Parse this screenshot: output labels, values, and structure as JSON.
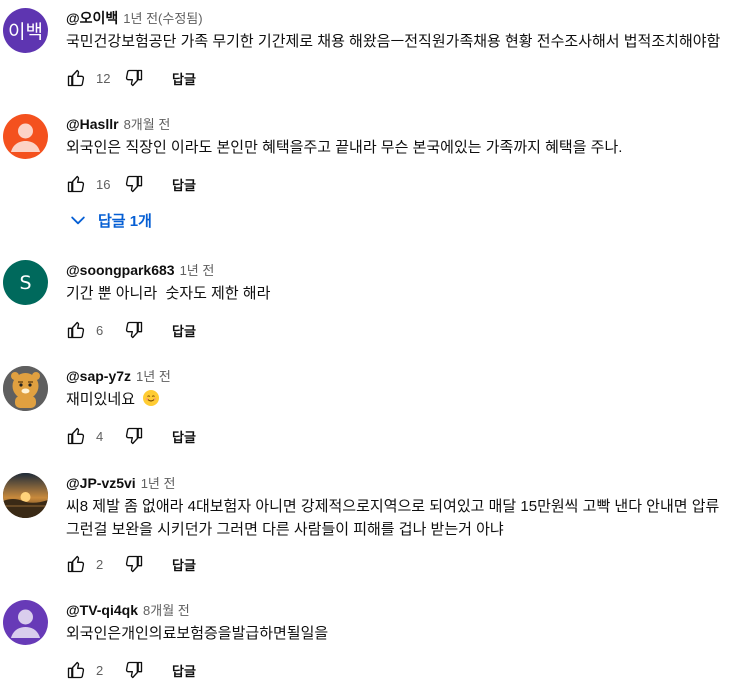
{
  "comments": [
    {
      "author": "@오이백",
      "time": "1년 전(수정됨)",
      "avatar_text": "이백",
      "avatar_color": "#5e35b1",
      "text": "국민건강보험공단 가족 무기한 기간제로 채용 해왔음ㅡ전직원가족채용 현황 전수조사해서 법적조치해야함",
      "likes": "12",
      "reply_label": "답글"
    },
    {
      "author": "@Hasllr",
      "time": "8개월 전",
      "avatar_color": "#f4511e",
      "text": "외국인은 직장인 이라도 본인만 혜택을주고 끝내라 무슨 본국에있는 가족까지 혜택을 주나.",
      "likes": "16",
      "reply_label": "답글"
    },
    {
      "author": "@soongpark683",
      "time": "1년 전",
      "avatar_text": "S",
      "avatar_color": "#00695c",
      "text": "기간 뿐 아니라  숫자도 제한 해라",
      "likes": "6",
      "reply_label": "답글"
    },
    {
      "author": "@sap-y7z",
      "time": "1년 전",
      "avatar_color": "#5f5f5f",
      "text": "재미있네요",
      "likes": "4",
      "reply_label": "답글"
    },
    {
      "author": "@JP-vz5vi",
      "time": "1년 전",
      "avatar_color": "#3b2a1a",
      "text_lines": [
        "씨8 제발 좀 없애라 4대보험자 아니면 강제적으로지역으로 되여있고 매달 15만원씩 고빡 낸다 안내면 압류",
        "그런걸 보완을 시키던가 그러면 다른 사람들이 피해를 겁나 받는거 아냐"
      ],
      "likes": "2",
      "reply_label": "답글"
    },
    {
      "author": "@TV-qi4qk",
      "time": "8개월 전",
      "avatar_color": "#673ab7",
      "text": "외국인은개인의료보험증을발급하면될일을",
      "likes": "2",
      "reply_label": "답글"
    }
  ],
  "replies_toggle": {
    "label": "답글 1개"
  },
  "colors": {
    "link_blue": "#065fd4",
    "meta_gray": "#606060"
  }
}
